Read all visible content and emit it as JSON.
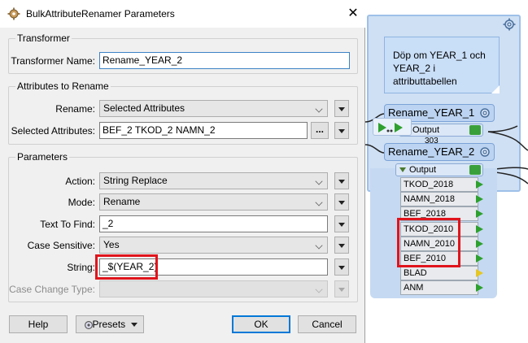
{
  "dialog": {
    "title": "BulkAttributeRenamer Parameters",
    "close_glyph": "✕",
    "groups": {
      "transformer": "Transformer",
      "attributes": "Attributes to Rename",
      "parameters": "Parameters"
    },
    "fields": {
      "transformer_name": {
        "label": "Transformer Name:",
        "value": "Rename_YEAR_2"
      },
      "rename": {
        "label": "Rename:",
        "value": "Selected Attributes"
      },
      "selected_attributes": {
        "label": "Selected Attributes:",
        "value": "BEF_2 TKOD_2 NAMN_2",
        "dots": "..."
      },
      "action": {
        "label": "Action:",
        "value": "String Replace"
      },
      "mode": {
        "label": "Mode:",
        "value": "Rename"
      },
      "text_to_find": {
        "label": "Text To Find:",
        "value": "_2"
      },
      "case_sensitive": {
        "label": "Case Sensitive:",
        "value": "Yes"
      },
      "string": {
        "label": "String:",
        "value": "_$(YEAR_2)"
      },
      "case_change_type": {
        "label": "Case Change Type:",
        "value": ""
      }
    },
    "buttons": {
      "help": "Help",
      "presets": "Presets",
      "ok": "OK",
      "cancel": "Cancel"
    }
  },
  "canvas": {
    "note_lines": [
      "Döp om YEAR_1 och",
      "YEAR_2 i",
      "attributtabellen"
    ],
    "transformer_1": {
      "name": "Rename_YEAR_1",
      "port": "Output"
    },
    "transformer_2": {
      "name": "Rename_YEAR_2",
      "port": "Output"
    },
    "feature_count": "303",
    "attributes": [
      "TKOD_2018",
      "NAMN_2018",
      "BEF_2018",
      "TKOD_2010",
      "NAMN_2010",
      "BEF_2010",
      "BLAD",
      "ANM"
    ]
  },
  "colors": {
    "highlight": "#e0141c",
    "bookmark_bg": "#cfe0f4",
    "transformer_bg": "#bcd4f1",
    "port_green": "#2ea02e",
    "port_yellow": "#e6c623"
  },
  "icons": {
    "app": "bulk-attribute-renamer-icon",
    "close": "close-icon",
    "gear": "gear-icon",
    "inspect": "inspect-icon",
    "presets": "presets-icon"
  }
}
